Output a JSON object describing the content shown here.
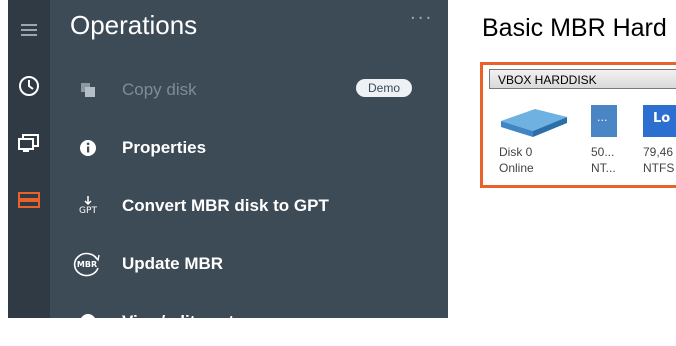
{
  "sidebar": {
    "icons": [
      "menu-icon",
      "clock-icon",
      "monitor-icon",
      "disk-stack-icon"
    ],
    "active_color": "#e8622a"
  },
  "panel": {
    "title": "Operations",
    "more": "···",
    "items": [
      {
        "label": "Copy disk",
        "badge": "Demo",
        "disabled": true,
        "icon": "copy-icon"
      },
      {
        "label": "Properties",
        "icon": "info-icon"
      },
      {
        "label": "Convert MBR disk to GPT",
        "icon": "gpt-convert-icon",
        "icon_text": "GPT"
      },
      {
        "label": "Update MBR",
        "icon": "mbr-icon",
        "icon_text": "MBR"
      },
      {
        "label": "View/edit sectors",
        "icon": "sectors-icon"
      }
    ]
  },
  "main": {
    "title": "Basic MBR Hard",
    "disk": {
      "model": "VBOX HARDDISK",
      "name": "Disk 0",
      "status": "Online",
      "partitions": [
        {
          "size": "50...",
          "fs": "NT...",
          "label": "..."
        },
        {
          "size": "79,46",
          "fs": "NTFS",
          "label": "Lo"
        }
      ]
    }
  }
}
